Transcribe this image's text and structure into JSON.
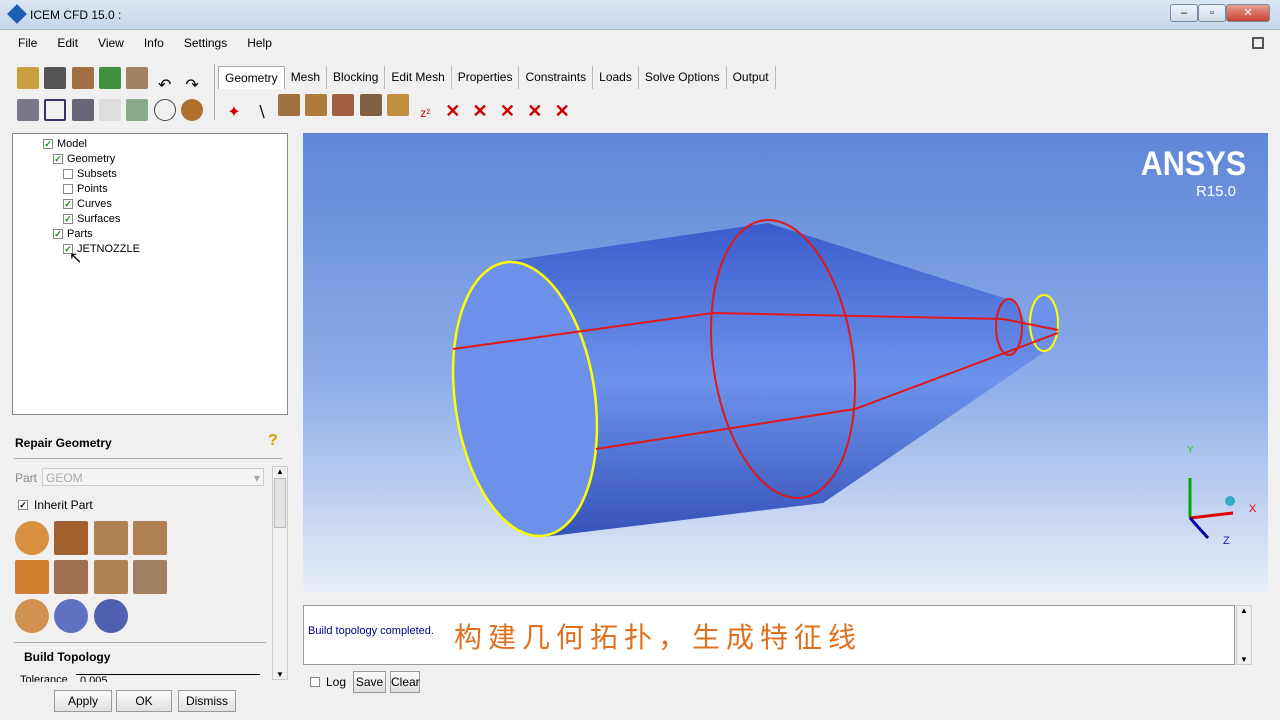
{
  "window": {
    "title": "ICEM CFD 15.0 :"
  },
  "menu": [
    "File",
    "Edit",
    "View",
    "Info",
    "Settings",
    "Help"
  ],
  "tabs": [
    "Geometry",
    "Mesh",
    "Blocking",
    "Edit Mesh",
    "Properties",
    "Constraints",
    "Loads",
    "Solve Options",
    "Output"
  ],
  "tree": {
    "model": "Model",
    "geometry": "Geometry",
    "subsets": "Subsets",
    "points": "Points",
    "curves": "Curves",
    "surfaces": "Surfaces",
    "parts": "Parts",
    "part1": "JETNOZZLE"
  },
  "panel": {
    "title": "Repair Geometry",
    "part_label": "Part",
    "part_value": "GEOM",
    "inherit_label": "Inherit Part",
    "build_topology": "Build Topology",
    "tolerance_label": "Tolerance",
    "tolerance_value": "0.005"
  },
  "buttons": {
    "apply": "Apply",
    "ok": "OK",
    "dismiss": "Dismiss",
    "log": "Log",
    "save": "Save",
    "clear": "Clear"
  },
  "viewport": {
    "brand": "ANSYS",
    "version": "R15.0",
    "axes": {
      "x": "X",
      "y": "Y",
      "z": "Z"
    }
  },
  "message": {
    "status": "Build topology completed.",
    "caption": "构建几何拓扑，生成特征线"
  }
}
